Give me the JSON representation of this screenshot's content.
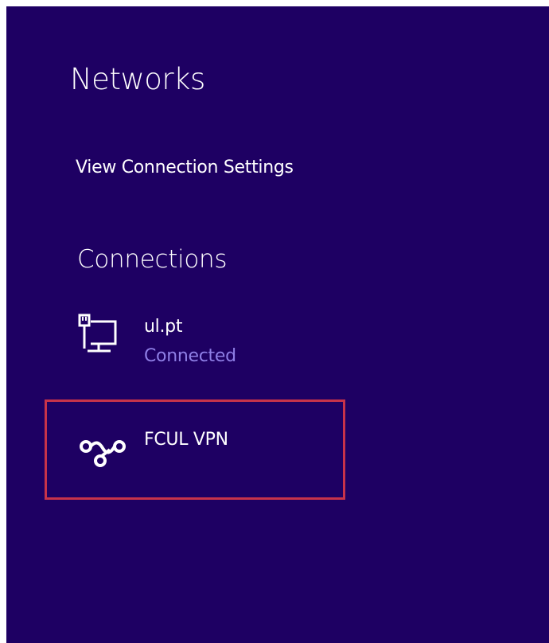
{
  "networks": {
    "title": "Networks",
    "view_settings_label": "View Connection Settings",
    "connections_heading": "Connections",
    "connections": [
      {
        "name": "ul.pt",
        "status": "Connected",
        "icon": "ethernet-icon"
      },
      {
        "name": "FCUL VPN",
        "status": "",
        "icon": "vpn-icon"
      }
    ]
  },
  "colors": {
    "background": "#1e0063",
    "text": "#ffffff",
    "status": "#8f7fe6",
    "highlight": "#c8334a"
  }
}
